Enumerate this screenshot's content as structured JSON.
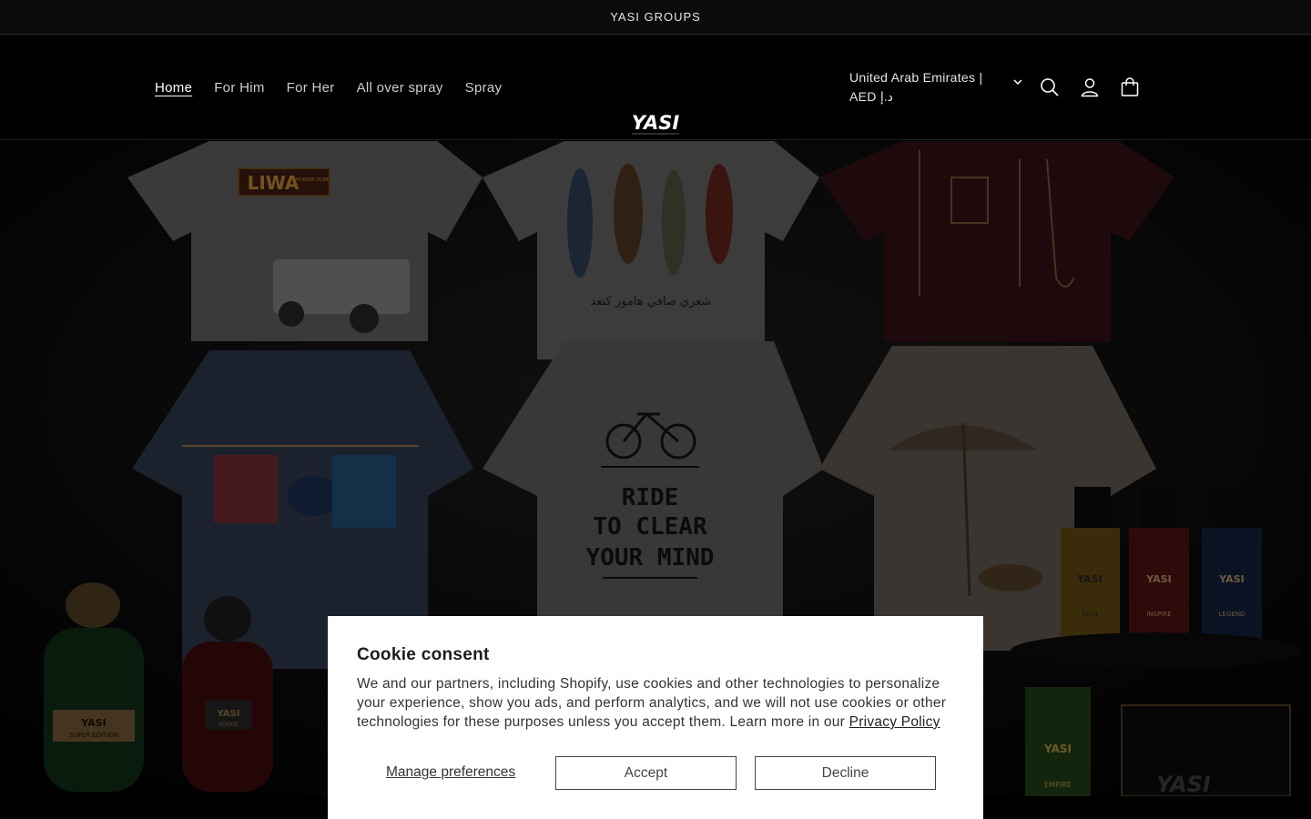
{
  "announcement": {
    "text": "YASI GROUPS"
  },
  "nav": {
    "items": [
      {
        "label": "Home",
        "active": true
      },
      {
        "label": "For Him"
      },
      {
        "label": "For Her"
      },
      {
        "label": "All over spray"
      },
      {
        "label": "Spray"
      }
    ]
  },
  "logo": {
    "text": "YASI"
  },
  "header": {
    "country_selector": "United Arab Emirates | AED د.إ",
    "icons": [
      "search-icon",
      "account-icon",
      "cart-icon"
    ]
  },
  "hero": {
    "shirts": [
      {
        "print": "LIWA",
        "subprint": "MOREEB DUNE"
      },
      {
        "print": "شعري  صافي  هامور  كنعد"
      },
      {
        "print": "fishing tackle"
      },
      {
        "print": "beach clothesline"
      },
      {
        "print": "RIDE TO CLEAR YOUR MIND"
      },
      {
        "print": "beach umbrella"
      }
    ],
    "bottles": [
      {
        "label": "YASI",
        "sub": "SUPER EDITION"
      },
      {
        "label": "YASI",
        "sub": "ROUGE"
      },
      {
        "label": "YASI",
        "sub": "RICH"
      },
      {
        "label": "YASI",
        "sub": "INSPIRE"
      },
      {
        "label": "YASI",
        "sub": "LEGEND"
      },
      {
        "label": "YASI",
        "sub": "EMPIRE"
      }
    ],
    "box_label": "YASI"
  },
  "cookie": {
    "title": "Cookie consent",
    "body": "We and our partners, including Shopify, use cookies and other technologies to personalize your experience, show you ads, and perform analytics, and we will not use cookies or other technologies for these purposes unless you accept them. Learn more in our ",
    "policy_link": "Privacy Policy",
    "manage_label": "Manage preferences",
    "accept_label": "Accept",
    "decline_label": "Decline"
  }
}
